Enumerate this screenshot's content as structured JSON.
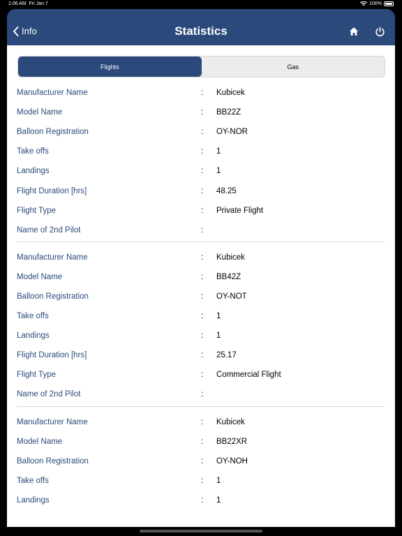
{
  "status": {
    "time": "1:06 AM",
    "date": "Fri Jan 7",
    "battery": "100%"
  },
  "nav": {
    "back_label": "Info",
    "title": "Statistics",
    "home_icon": "home-icon",
    "power_icon": "power-icon",
    "bar_color": "#2b4a7b"
  },
  "tabs": [
    {
      "label": "Flights",
      "active": true
    },
    {
      "label": "Gas",
      "active": false
    }
  ],
  "colon": ":",
  "records": [
    {
      "rows": [
        {
          "label": "Manufacturer Name",
          "value": "Kubicek"
        },
        {
          "label": "Model Name",
          "value": "BB22Z"
        },
        {
          "label": "Balloon Registration",
          "value": "OY-NOR"
        },
        {
          "label": "Take offs",
          "value": "1"
        },
        {
          "label": "Landings",
          "value": "1"
        },
        {
          "label": "Flight Duration [hrs]",
          "value": "48.25"
        },
        {
          "label": "Flight Type",
          "value": "Private Flight"
        },
        {
          "label": "Name of 2nd Pilot",
          "value": ""
        }
      ]
    },
    {
      "rows": [
        {
          "label": "Manufacturer Name",
          "value": "Kubicek"
        },
        {
          "label": "Model Name",
          "value": "BB42Z"
        },
        {
          "label": "Balloon Registration",
          "value": "OY-NOT"
        },
        {
          "label": "Take offs",
          "value": "1"
        },
        {
          "label": "Landings",
          "value": "1"
        },
        {
          "label": "Flight Duration [hrs]",
          "value": "25.17"
        },
        {
          "label": "Flight Type",
          "value": "Commercial Flight"
        },
        {
          "label": "Name of 2nd Pilot",
          "value": ""
        }
      ]
    },
    {
      "rows": [
        {
          "label": "Manufacturer Name",
          "value": "Kubicek"
        },
        {
          "label": "Model Name",
          "value": "BB22XR"
        },
        {
          "label": "Balloon Registration",
          "value": "OY-NOH"
        },
        {
          "label": "Take offs",
          "value": "1"
        },
        {
          "label": "Landings",
          "value": "1"
        }
      ]
    }
  ]
}
